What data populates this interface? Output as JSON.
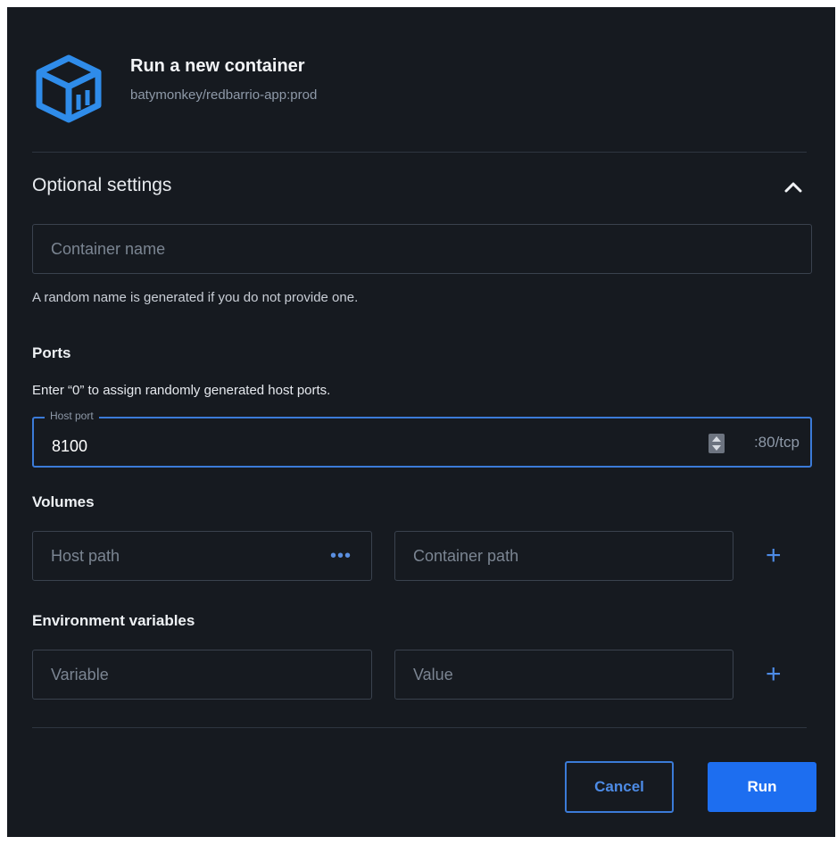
{
  "header": {
    "icon": "docker-container-icon",
    "title": "Run a new container",
    "image": "batymonkey/redbarrio-app:prod"
  },
  "optional_settings": {
    "title": "Optional settings",
    "expanded": true,
    "container_name": {
      "placeholder": "Container name",
      "value": "",
      "helper": "A random name is generated if you do not provide one."
    }
  },
  "ports": {
    "label": "Ports",
    "helper": "Enter “0” to assign randomly generated host ports.",
    "host_port_label": "Host port",
    "host_port_value": "8100",
    "container_port": ":80/tcp"
  },
  "volumes": {
    "label": "Volumes",
    "host_path_placeholder": "Host path",
    "container_path_placeholder": "Container path",
    "browse_label": "•••"
  },
  "env": {
    "label": "Environment variables",
    "variable_placeholder": "Variable",
    "value_placeholder": "Value"
  },
  "actions": {
    "cancel": "Cancel",
    "run": "Run"
  },
  "colors": {
    "accent": "#1d6ef0",
    "background": "#161a20",
    "border": "#3a424e"
  }
}
